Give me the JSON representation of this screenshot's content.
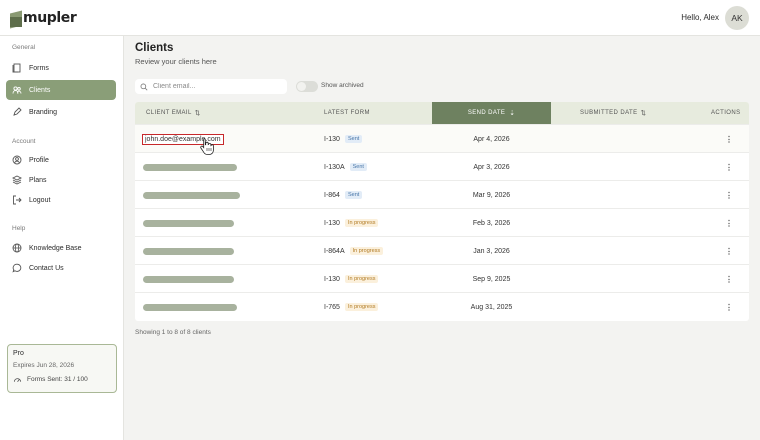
{
  "app": {
    "brand": "mupler"
  },
  "header": {
    "greeting": "Hello, Alex",
    "avatar_initials": "AK"
  },
  "sidebar": {
    "sections": {
      "general": "General",
      "account": "Account",
      "help": "Help"
    },
    "items": [
      {
        "label": "Forms",
        "icon": "forms-icon",
        "active": false
      },
      {
        "label": "Clients",
        "icon": "clients-icon",
        "active": true
      },
      {
        "label": "Branding",
        "icon": "branding-icon",
        "active": false
      },
      {
        "label": "Profile",
        "icon": "profile-icon",
        "active": false
      },
      {
        "label": "Plans",
        "icon": "plans-icon",
        "active": false
      },
      {
        "label": "Logout",
        "icon": "logout-icon",
        "active": false
      },
      {
        "label": "Knowledge Base",
        "icon": "globe-icon",
        "active": false
      },
      {
        "label": "Contact Us",
        "icon": "chat-icon",
        "active": false
      }
    ],
    "plan": {
      "name": "Pro",
      "expires": "Expires Jun 28, 2026",
      "forms_sent": "Forms Sent: 31 / 100"
    }
  },
  "page": {
    "title": "Clients",
    "subtitle": "Review your clients here"
  },
  "search": {
    "placeholder": "Client email..."
  },
  "toggle": {
    "label": "Show archived",
    "on": false
  },
  "table": {
    "columns": {
      "email": "CLIENT EMAIL",
      "form": "LATEST FORM",
      "send_date": "SEND DATE",
      "submitted": "SUBMITTED DATE",
      "actions": "ACTIONS"
    },
    "rows": [
      {
        "email": "john.doe@example.com",
        "redacted": false,
        "form": "I-130",
        "status": "Sent",
        "send_date": "Apr 4, 2026",
        "submitted": "",
        "action": "⋮"
      },
      {
        "email": "",
        "redacted": true,
        "form": "I-130A",
        "status": "Sent",
        "send_date": "Apr 3, 2026",
        "submitted": "",
        "action": "⋮"
      },
      {
        "email": "",
        "redacted": true,
        "form": "I-864",
        "status": "Sent",
        "send_date": "Mar 9, 2026",
        "submitted": "",
        "action": "⋮"
      },
      {
        "email": "",
        "redacted": true,
        "form": "I-130",
        "status": "In progress",
        "send_date": "Feb 3, 2026",
        "submitted": "",
        "action": "⋮"
      },
      {
        "email": "",
        "redacted": true,
        "form": "I-864A",
        "status": "In progress",
        "send_date": "Jan 3, 2026",
        "submitted": "",
        "action": "⋮"
      },
      {
        "email": "",
        "redacted": true,
        "form": "I-130",
        "status": "In progress",
        "send_date": "Sep 9, 2025",
        "submitted": "",
        "action": "⋮"
      },
      {
        "email": "",
        "redacted": true,
        "form": "I-765",
        "status": "In progress",
        "send_date": "Aug 31, 2025",
        "submitted": "",
        "action": "⋮"
      }
    ]
  },
  "footer": {
    "showing": "Showing 1 to 8 of 8 clients"
  },
  "colors": {
    "accent": "#8a9e78",
    "sorted_header": "#6e8160",
    "highlight": "#c7282b",
    "sent_badge": "#e2ecf7",
    "progress_badge": "#fbf0dc"
  }
}
